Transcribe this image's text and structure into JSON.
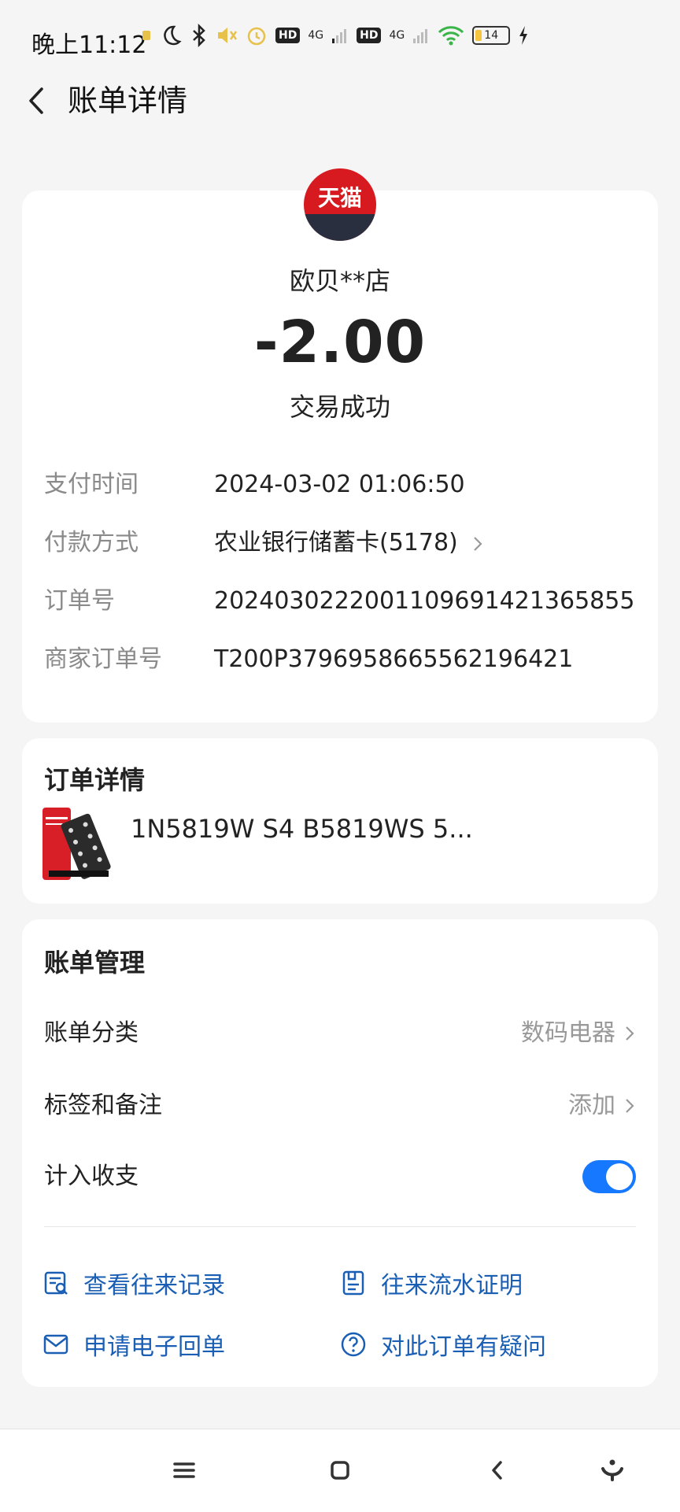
{
  "status_bar": {
    "time": "晚上11:12",
    "hd1": "HD",
    "net1": "4G",
    "hd2": "HD",
    "net2": "4G",
    "battery": "14"
  },
  "header": {
    "title": "账单详情"
  },
  "transaction": {
    "logo_text": "天猫",
    "merchant": "欧贝**店",
    "amount": "-2.00",
    "status": "交易成功"
  },
  "details": [
    {
      "label": "支付时间",
      "value": "2024-03-02 01:06:50"
    },
    {
      "label": "付款方式",
      "value": "农业银行储蓄卡(5178)"
    },
    {
      "label": "订单号",
      "value": "2024030222001109691421365855"
    },
    {
      "label": "商家订单号",
      "value": "T200P3796958665562196421"
    }
  ],
  "order": {
    "title": "订单详情",
    "product_name": "1N5819W S4 B5819WS 5..."
  },
  "management": {
    "title": "账单管理",
    "category_label": "账单分类",
    "category_value": "数码电器",
    "tags_label": "标签和备注",
    "tags_value": "添加",
    "include_label": "计入收支",
    "include_enabled": true
  },
  "actions": {
    "view_records": "查看往来记录",
    "flow_proof": "往来流水证明",
    "e_receipt": "申请电子回单",
    "question": "对此订单有疑问"
  },
  "colors": {
    "accent": "#1677ff",
    "link": "#1a5fb4",
    "tmall_red": "#d71920"
  }
}
